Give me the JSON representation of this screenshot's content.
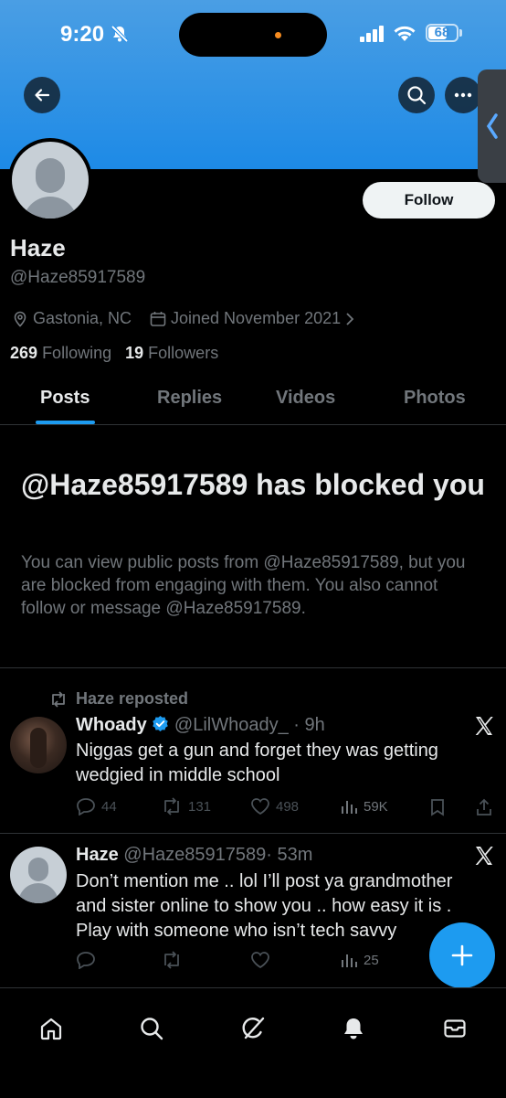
{
  "status_bar": {
    "time": "9:20",
    "battery": "68",
    "battery_level": 0.68
  },
  "profile": {
    "name": "Haze",
    "handle": "@Haze85917589",
    "location": "Gastonia, NC",
    "joined": "Joined November 2021",
    "following_count": "269",
    "following_label": "Following",
    "followers_count": "19",
    "followers_label": "Followers",
    "follow_label": "Follow"
  },
  "tabs": [
    {
      "label": "Posts",
      "active": true
    },
    {
      "label": "Replies"
    },
    {
      "label": "Videos"
    },
    {
      "label": "Photos"
    }
  ],
  "blocked": {
    "title": "@Haze85917589 has blocked you",
    "body": "You can view public posts from @Haze85917589, but you are blocked from engaging with them. You also cannot follow or message @Haze85917589."
  },
  "posts": [
    {
      "repost_label": "Haze reposted",
      "author": "Whoady",
      "handle": "@LilWhoady_",
      "time": "· 9h",
      "text": "Niggas get a gun and forget they was getting wedgied in middle school",
      "replies": "44",
      "reposts": "131",
      "likes": "498",
      "views": "59K"
    },
    {
      "author": "Haze",
      "handle": "@Haze85917589",
      "time": "· 53m",
      "text": "Don’t mention me .. lol I’ll post ya grandmother and sister online to show you .. how easy it is . Play with someone who isn’t tech savvy",
      "views": "25"
    }
  ],
  "colors": {
    "accent": "#1d9bf0",
    "banner": "#1d8ae6",
    "muted": "#71767b",
    "text": "#e7e9ea"
  },
  "icons": [
    "back-arrow-icon",
    "search-icon",
    "more-icon",
    "location-icon",
    "calendar-icon",
    "chevron-right-icon",
    "repost-icon",
    "verified-badge-icon",
    "x-logo-icon",
    "reply-icon",
    "like-icon",
    "views-icon",
    "bookmark-icon",
    "share-icon",
    "plus-icon",
    "home-icon",
    "grok-icon",
    "notifications-icon",
    "messages-icon"
  ]
}
